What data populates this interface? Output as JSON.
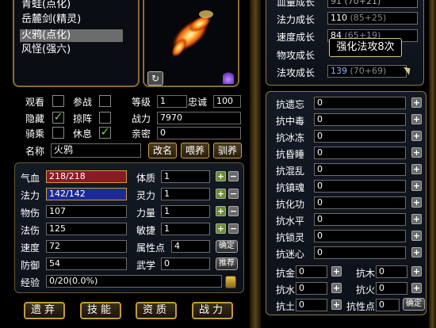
{
  "pet_list": {
    "items": [
      {
        "label": "青蛙(点化)"
      },
      {
        "label": "岳麓剑(精灵)"
      },
      {
        "label": "火鸦(点化)"
      },
      {
        "label": "风怪(强六)"
      }
    ]
  },
  "growth": {
    "top_partial_label": "血量成长",
    "top_partial_value": "91 (70+21)",
    "rows": [
      {
        "label": "法力成长",
        "value": "110",
        "detail": "(85+25)"
      },
      {
        "label": "速度成长",
        "value": "84",
        "detail": "(65+19)"
      },
      {
        "label": "物攻成长",
        "value": "",
        "detail": ""
      },
      {
        "label": "法攻成长",
        "value": "139",
        "detail": "(70+69)"
      }
    ],
    "tooltip": "强化法攻8次"
  },
  "toggles": {
    "watch": "观看",
    "battle": "参战",
    "hide": "隐藏",
    "plunder": "掠阵",
    "ride": "骑乘",
    "rest": "休息"
  },
  "info": {
    "level_label": "等级",
    "level": "1",
    "loyalty_label": "忠诚",
    "loyalty": "100",
    "power_label": "战力",
    "power": "7970",
    "intimacy_label": "亲密",
    "intimacy": "0",
    "name_label": "名称",
    "name": "火鸦"
  },
  "actions": {
    "rename": "改名",
    "feed": "喂养",
    "tame": "驯养"
  },
  "stats": {
    "hp_label": "气血",
    "hp": "218/218",
    "mp_label": "法力",
    "mp": "142/142",
    "patk_label": "物伤",
    "patk": "107",
    "matk_label": "法伤",
    "matk": "125",
    "speed_label": "速度",
    "speed": "72",
    "def_label": "防御",
    "def": "54",
    "con_label": "体质",
    "con": "1",
    "spi_label": "灵力",
    "spi": "1",
    "str_label": "力量",
    "str": "1",
    "agi_label": "敏捷",
    "agi": "1",
    "points_label": "属性点",
    "points": "4",
    "martial_label": "武学",
    "martial": "0",
    "confirm": "确定",
    "recommend": "推荐",
    "exp_label": "经验",
    "exp": "0/20(0.0%)"
  },
  "bottom_buttons": [
    "遗弃",
    "技能",
    "资质",
    "战力"
  ],
  "resist": {
    "rows": [
      {
        "label": "抗遗忘",
        "value": "0"
      },
      {
        "label": "抗中毒",
        "value": "0"
      },
      {
        "label": "抗冰冻",
        "value": "0"
      },
      {
        "label": "抗昏睡",
        "value": "0"
      },
      {
        "label": "抗混乱",
        "value": "0"
      },
      {
        "label": "抗镇魂",
        "value": "0"
      },
      {
        "label": "抗化功",
        "value": "0"
      },
      {
        "label": "抗水平",
        "value": "0"
      },
      {
        "label": "抗锁灵",
        "value": "0"
      },
      {
        "label": "抗迷心",
        "value": "0"
      }
    ],
    "elements": [
      {
        "label": "抗金",
        "value": "0"
      },
      {
        "label": "抗木",
        "value": "0"
      },
      {
        "label": "抗水",
        "value": "0"
      },
      {
        "label": "抗火",
        "value": "0"
      },
      {
        "label": "抗土",
        "value": "0"
      }
    ],
    "points_label": "抗性点",
    "points": "0",
    "confirm": "确定"
  }
}
